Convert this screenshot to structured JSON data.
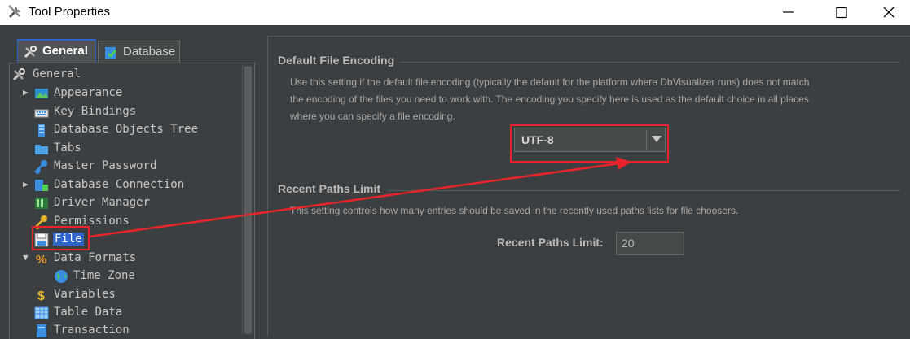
{
  "window": {
    "title": "Tool Properties",
    "controls": [
      "minimize",
      "maximize",
      "close"
    ]
  },
  "tabs": [
    {
      "label": "General",
      "icon": "tools-icon",
      "active": true
    },
    {
      "label": "Database",
      "icon": "database-icon",
      "active": false
    }
  ],
  "tree": {
    "items": [
      {
        "label": "General",
        "icon": "tools-icon",
        "expander": "",
        "level": 0
      },
      {
        "label": "Appearance",
        "icon": "appearance-icon",
        "expander": "▶",
        "level": 1
      },
      {
        "label": "Key Bindings",
        "icon": "keyboard-icon",
        "expander": "",
        "level": 1
      },
      {
        "label": "Database Objects Tree",
        "icon": "tree-icon",
        "expander": "",
        "level": 1
      },
      {
        "label": "Tabs",
        "icon": "folder-tab-icon",
        "expander": "",
        "level": 1
      },
      {
        "label": "Master Password",
        "icon": "key-icon",
        "expander": "",
        "level": 1
      },
      {
        "label": "Database Connection",
        "icon": "database-connection-icon",
        "expander": "▶",
        "level": 1
      },
      {
        "label": "Driver Manager",
        "icon": "driver-icon",
        "expander": "",
        "level": 1
      },
      {
        "label": "Permissions",
        "icon": "permission-key-icon",
        "expander": "",
        "level": 1
      },
      {
        "label": "File",
        "icon": "file-save-icon",
        "expander": "",
        "level": 1,
        "selected": true
      },
      {
        "label": "Data Formats",
        "icon": "percent-icon",
        "expander": "▼",
        "level": 1
      },
      {
        "label": "Time Zone",
        "icon": "globe-icon",
        "expander": "",
        "level": 2
      },
      {
        "label": "Variables",
        "icon": "dollar-icon",
        "expander": "",
        "level": 1
      },
      {
        "label": "Table Data",
        "icon": "table-icon",
        "expander": "",
        "level": 1
      },
      {
        "label": "Transaction",
        "icon": "transaction-icon",
        "expander": "",
        "level": 1
      }
    ]
  },
  "encoding": {
    "title": "Default File Encoding",
    "description_lines": [
      "Use this setting if the default file encoding (typically the default for the platform where DbVisualizer runs) does not match",
      "the encoding of the files you need to work with. The encoding you specify here is used as the default choice in all places",
      "where you can specify a file encoding."
    ],
    "selected": "UTF-8"
  },
  "recent_paths": {
    "title": "Recent Paths Limit",
    "description": "This setting controls how many entries should be saved in the recently used paths lists for file choosers.",
    "field_label": "Recent Paths Limit:",
    "value": "20"
  },
  "colors": {
    "background": "#3c3f41",
    "selection": "#2f65ca",
    "annotation": "#e8232a"
  }
}
